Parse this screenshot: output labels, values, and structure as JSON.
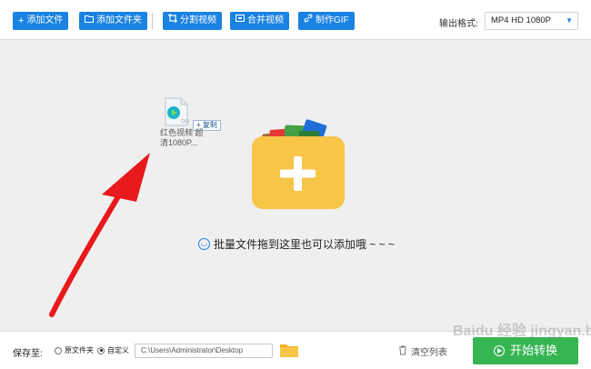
{
  "toolbar": {
    "add_file": "添加文件",
    "add_folder": "添加文件夹",
    "split_video": "分割视频",
    "merge_video": "合并视频",
    "make_gif": "制作GIF",
    "output_format_label": "输出格式:",
    "output_format_value": "MP4  HD 1080P"
  },
  "drop_area": {
    "hint": "批量文件拖到这里也可以添加哦 ~ ~ ~",
    "dragged_file_label": "红色视频 超清1080P...",
    "copy_tag": "+ 复制"
  },
  "bottom": {
    "save_to_label": "保存至:",
    "radio_original": "原文件夹",
    "radio_custom": "自定义",
    "custom_selected": true,
    "path_value": "C:\\Users\\Administrator\\Desktop",
    "clear_list": "清空列表",
    "start_convert": "开始转换"
  },
  "watermark": "Baidu 经验 jingyan.baidu.com",
  "colors": {
    "primary": "#1a82e2",
    "start_green": "#36b553",
    "folder_yellow": "#f7c548",
    "arrow_red": "#e8191c"
  },
  "icons": [
    "plus-icon",
    "folder-icon",
    "crop-icon",
    "merge-icon",
    "link-icon",
    "smile-icon",
    "trash-icon",
    "play-icon",
    "big-folder-add-icon"
  ]
}
